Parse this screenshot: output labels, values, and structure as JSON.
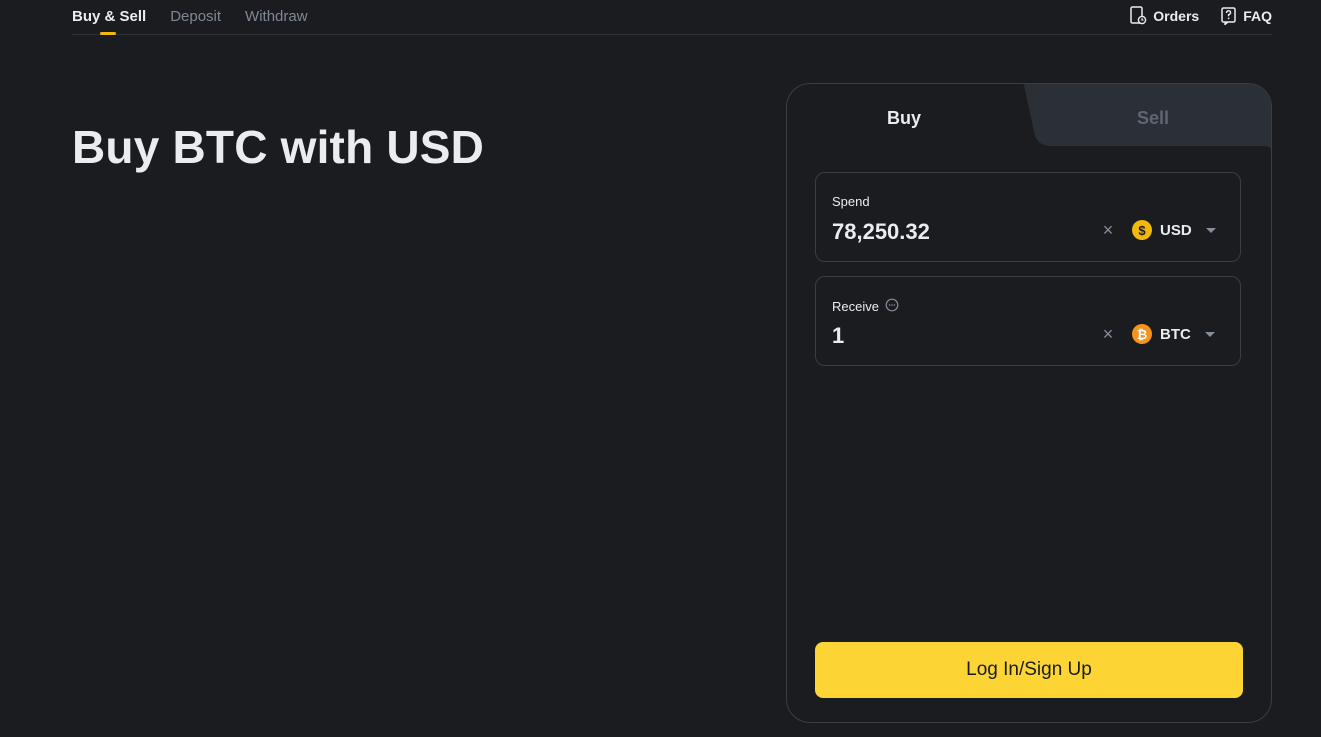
{
  "nav": {
    "tabs": [
      {
        "label": "Buy & Sell",
        "active": true
      },
      {
        "label": "Deposit",
        "active": false
      },
      {
        "label": "Withdraw",
        "active": false
      }
    ],
    "orders_label": "Orders",
    "faq_label": "FAQ"
  },
  "headline": "Buy BTC with USD",
  "trade": {
    "buy_tab": "Buy",
    "sell_tab": "Sell",
    "spend": {
      "label": "Spend",
      "value": "78,250.32",
      "currency": "USD",
      "coin_symbol": "$"
    },
    "receive": {
      "label": "Receive",
      "value": "1",
      "currency": "BTC",
      "coin_symbol": "₿"
    },
    "clear_symbol": "×",
    "submit_label": "Log In/Sign Up"
  },
  "colors": {
    "background": "#1b1c20",
    "accent": "#f0b90b",
    "button": "#fcd535",
    "btc": "#f7931a"
  },
  "icons": {
    "orders": "orders-icon",
    "faq": "faq-icon",
    "info": "info-icon",
    "clear": "close-icon",
    "dropdown": "chevron-down-icon"
  }
}
